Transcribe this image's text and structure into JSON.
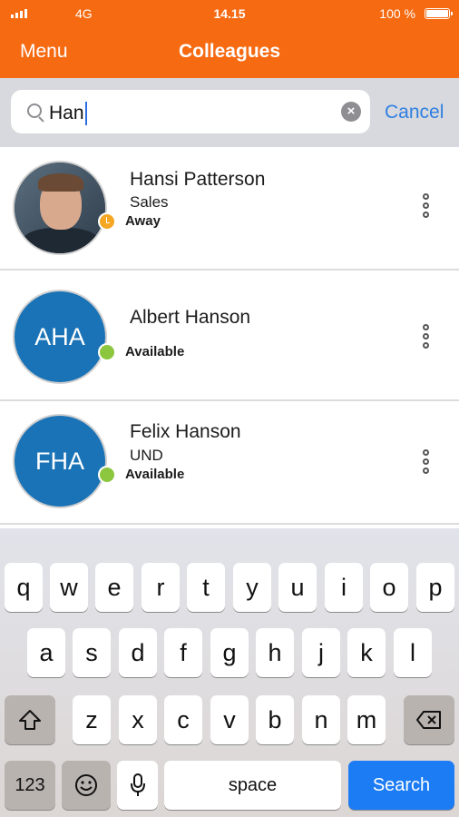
{
  "status_bar": {
    "carrier": "4G",
    "time": "14.15",
    "battery": "100 %"
  },
  "nav": {
    "menu_label": "Menu",
    "title": "Colleagues"
  },
  "search": {
    "value": "Han",
    "cancel_label": "Cancel"
  },
  "contacts": [
    {
      "name": "Hansi Patterson",
      "department": "Sales",
      "presence": "Away",
      "initials": ""
    },
    {
      "name": "Albert Hanson",
      "department": "",
      "presence": "Available",
      "initials": "AHA"
    },
    {
      "name": "Felix Hanson",
      "department": "UND",
      "presence": "Available",
      "initials": "FHA"
    }
  ],
  "keyboard": {
    "row1": [
      "q",
      "w",
      "e",
      "r",
      "t",
      "y",
      "u",
      "i",
      "o",
      "p"
    ],
    "row2": [
      "a",
      "s",
      "d",
      "f",
      "g",
      "h",
      "j",
      "k",
      "l"
    ],
    "row3": [
      "z",
      "x",
      "c",
      "v",
      "b",
      "n",
      "m"
    ],
    "numbers_label": "123",
    "space_label": "space",
    "search_label": "Search"
  },
  "colors": {
    "brand": "#f66a12",
    "link": "#2f7fe0",
    "avatar": "#1a73b6",
    "away": "#f5a623",
    "available": "#8cc63f"
  }
}
